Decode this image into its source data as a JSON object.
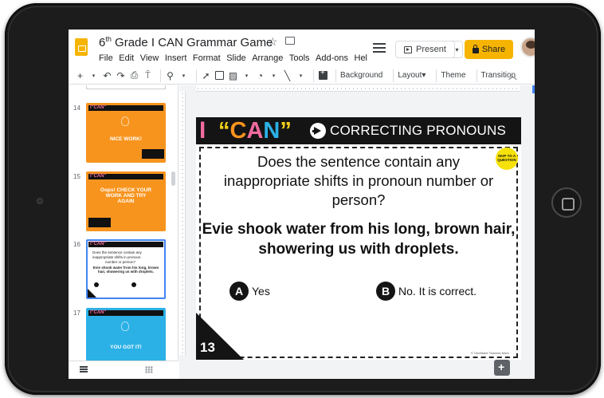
{
  "header": {
    "doc_title_prefix": "6",
    "doc_title_sup": "th",
    "doc_title_rest": " Grade I CAN Grammar Game",
    "menus": [
      "File",
      "Edit",
      "View",
      "Insert",
      "Format",
      "Slide",
      "Arrange",
      "Tools",
      "Add-ons",
      "Hel"
    ],
    "present_label": "Present",
    "share_label": "Share"
  },
  "toolbar": {
    "items": [
      "Background",
      "Layout▾",
      "Theme",
      "Transition"
    ]
  },
  "filmstrip": {
    "slides": [
      {
        "number": "14",
        "text": "NICE WORK!"
      },
      {
        "number": "15",
        "text": "Oops! CHECK YOUR WORK AND TRY AGAIN"
      },
      {
        "number": "16",
        "text": "Evie shook water from his long, brown hair, showering us with droplets."
      },
      {
        "number": "17",
        "text": "YOU GOT IT!"
      }
    ]
  },
  "slide": {
    "title_i": "I",
    "title_can_open": "“",
    "title_can_c": "C",
    "title_can_a": "A",
    "title_can_n": "N",
    "title_can_close": "”",
    "heading": "CORRECTING PRONOUNS",
    "question": "Does the sentence contain any inappropriate shifts in pronoun number or person?",
    "sentence": "Evie shook water from his long, brown hair, showering us with droplets.",
    "choice_a_letter": "A",
    "choice_a": "Yes",
    "choice_b_letter": "B",
    "choice_b": "No.  It is correct.",
    "badge": "SKIP TO A QUESTION",
    "number": "13",
    "copyright": "© OneMarie Teaches More"
  },
  "colors": {
    "share": "#f6b400",
    "orange_slide": "#f7941e",
    "blue_slide": "#2bb1e6",
    "pink": "#f06ba0"
  }
}
